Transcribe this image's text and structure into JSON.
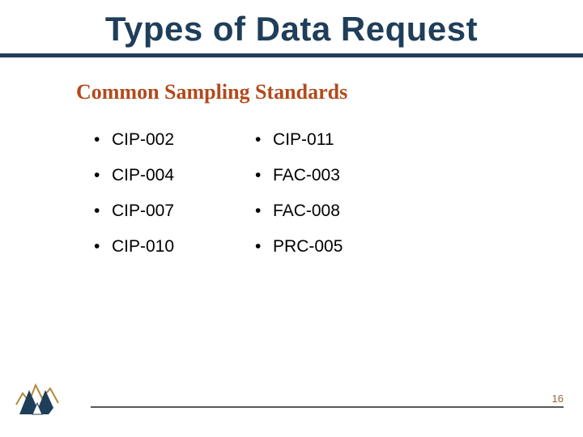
{
  "title": "Types of Data Request",
  "subtitle": "Common Sampling Standards",
  "columns": {
    "left": [
      "CIP-002",
      "CIP-004",
      "CIP-007",
      "CIP-010"
    ],
    "right": [
      "CIP-011",
      "FAC-003",
      "FAC-008",
      "PRC-005"
    ]
  },
  "page_number": "16"
}
